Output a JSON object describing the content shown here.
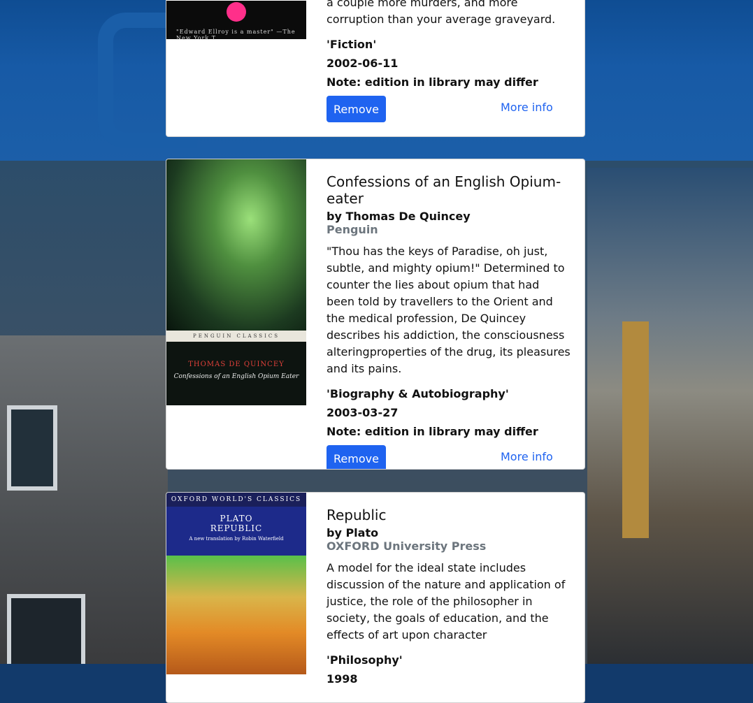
{
  "books": [
    {
      "title": "",
      "author": "",
      "publisher": "",
      "description": "a couple more murders, and more corruption than your average graveyard.",
      "category": "'Fiction'",
      "date": "2002-06-11",
      "note": "Note: edition in library may differ",
      "remove_label": "Remove",
      "more_info_label": "More info",
      "cover_quote": "\"Edward Ellroy is a master\" —The New York T"
    },
    {
      "title": "Confessions of an English Opium-eater",
      "author": "by Thomas De Quincey",
      "publisher": "Penguin",
      "description": "\"Thou has the keys of Paradise, oh just, subtle, and mighty opium!\" Determined to counter the lies about opium that had been told by travellers to the Orient and the medical profession, De Quincey describes his addiction, the consciousness alteringproperties of the drug, its pleasures and its pains.",
      "category": "'Biography & Autobiography'",
      "date": "2003-03-27",
      "note": "Note: edition in library may differ",
      "remove_label": "Remove",
      "more_info_label": "More info",
      "cover_band": "PENGUIN CLASSICS",
      "cover_author": "THOMAS DE QUINCEY",
      "cover_title": "Confessions of an English Opium Eater"
    },
    {
      "title": "Republic",
      "author": "by Plato",
      "publisher": "OXFORD University Press",
      "description": "A model for the ideal state includes discussion of the nature and application of justice, the role of the philosopher in society, the goals of education, and the effects of art upon character",
      "category": "'Philosophy'",
      "date": "1998",
      "cover_series": "OXFORD WORLD'S CLASSICS",
      "cover_author": "PLATO",
      "cover_title": "REPUBLIC",
      "cover_translation": "A new translation by Robin Waterfield"
    }
  ],
  "colors": {
    "primary": "#1f63f0",
    "muted": "#6c757d",
    "card_bg": "#ffffff"
  }
}
